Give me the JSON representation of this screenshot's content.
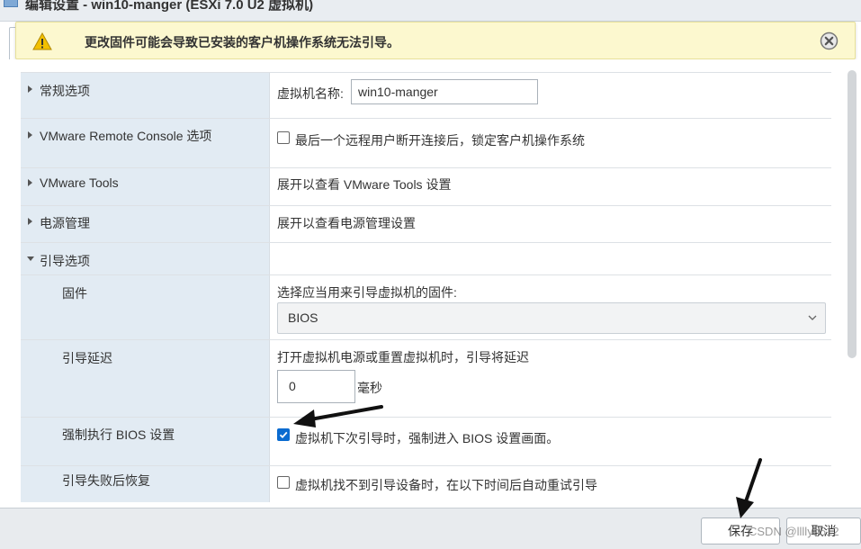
{
  "window": {
    "title": "编辑设置 - win10-manger (ESXi 7.0 U2 虚拟机)"
  },
  "warning": {
    "text": "更改固件可能会导致已安装的客户机操作系统无法引导。",
    "icon": "warning-triangle-icon",
    "close_icon": "close-circle-icon"
  },
  "settings": {
    "general": {
      "label": "常规选项",
      "vm_name_label": "虚拟机名称:",
      "vm_name_value": "win10-manger"
    },
    "vmrc": {
      "label": "VMware Remote Console 选项",
      "lock_label": "最后一个远程用户断开连接后，锁定客户机操作系统",
      "lock_checked": false
    },
    "tools": {
      "label": "VMware Tools",
      "info": "展开以查看 VMware Tools 设置"
    },
    "power": {
      "label": "电源管理",
      "info": "展开以查看电源管理设置"
    },
    "boot": {
      "label": "引导选项",
      "firmware": {
        "label": "固件",
        "desc": "选择应当用来引导虚拟机的固件:",
        "selected": "BIOS"
      },
      "delay": {
        "label": "引导延迟",
        "desc": "打开虚拟机电源或重置虚拟机时，引导将延迟",
        "value": "0",
        "unit": "毫秒"
      },
      "force_bios": {
        "label": "强制执行 BIOS 设置",
        "checkbox_label": "虚拟机下次引导时，强制进入 BIOS 设置画面。",
        "checked": true
      },
      "recovery": {
        "label": "引导失败后恢复",
        "checkbox_label": "虚拟机找不到引导设备时，在以下时间后自动重试引导",
        "checked": false
      }
    }
  },
  "footer": {
    "save_label": "保存",
    "cancel_label": "取消"
  },
  "watermark": "CSDN @llllyh512",
  "colors": {
    "label_bg": "#e2ebf3",
    "warning_bg": "#fcf8cf",
    "checkbox_checked": "#0a6bd0"
  }
}
